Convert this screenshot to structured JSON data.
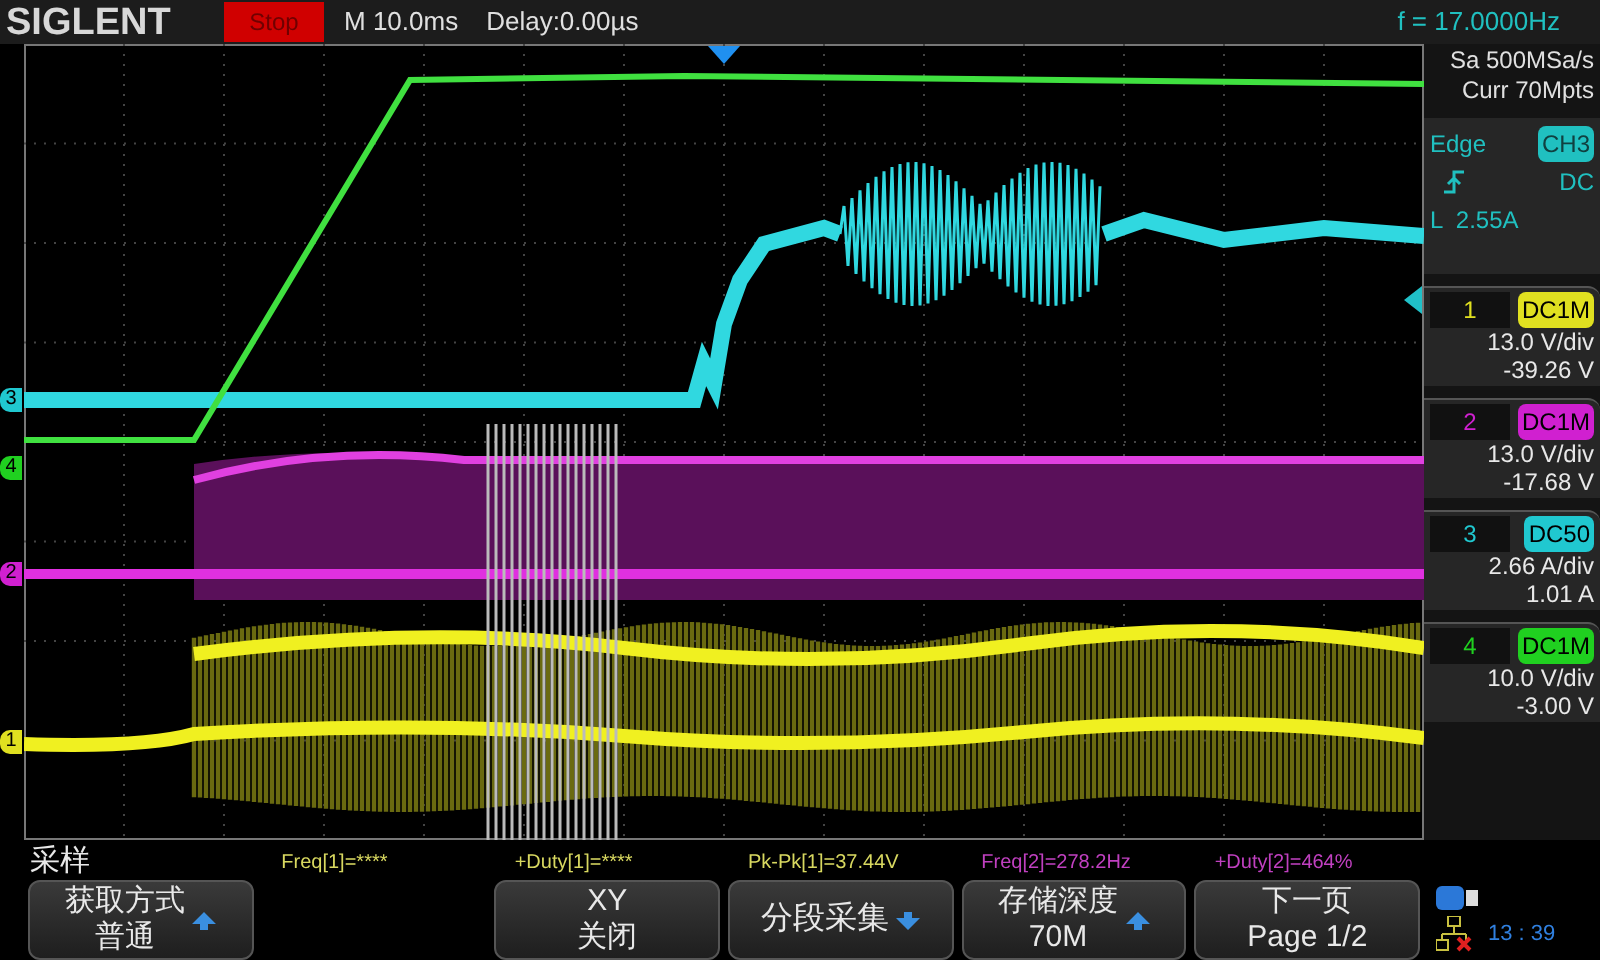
{
  "top_bar": {
    "logo": "SIGLENT",
    "run_state": "Stop",
    "timebase": "M 10.0ms",
    "delay": "Delay:0.00µs",
    "frequency": "f = 17.0000Hz"
  },
  "acquisition": {
    "sample_rate": "Sa 500MSa/s",
    "memory": "Curr 70Mpts"
  },
  "trigger": {
    "type": "Edge",
    "source": "CH3",
    "coupling": "DC",
    "level": "L  2.55A"
  },
  "channels": [
    {
      "number": "1",
      "coupling": "DC1M",
      "scale": "13.0 V/div",
      "offset": "-39.26 V",
      "color": "#e0e020"
    },
    {
      "number": "2",
      "coupling": "DC1M",
      "scale": "13.0 V/div",
      "offset": "-17.68 V",
      "color": "#d020d0"
    },
    {
      "number": "3",
      "coupling": "DC50",
      "scale": "2.66 A/div",
      "offset": "1.01 A",
      "color": "#20c8d0"
    },
    {
      "number": "4",
      "coupling": "DC1M",
      "scale": "10.0 V/div",
      "offset": "-3.00 V",
      "color": "#20d020"
    }
  ],
  "trace_markers": [
    {
      "label": "3",
      "color": "#20c8d0"
    },
    {
      "label": "4",
      "color": "#20d020"
    },
    {
      "label": "2",
      "color": "#d020d0"
    },
    {
      "label": "1",
      "color": "#e0e020"
    }
  ],
  "menu_title": "采样",
  "measurements": [
    {
      "text": "Freq[1]=****",
      "color": "#d8d860"
    },
    {
      "text": "+Duty[1]=****",
      "color": "#d8d860"
    },
    {
      "text": "Pk-Pk[1]=37.44V",
      "color": "#d8d860"
    },
    {
      "text": "Freq[2]=278.2Hz",
      "color": "#c040c0"
    },
    {
      "text": "+Duty[2]=464%",
      "color": "#c040c0"
    }
  ],
  "softkeys": [
    {
      "kind": "two_line",
      "title": "获取方式",
      "value": "普通",
      "arrow": true,
      "arrow_up": true
    },
    {
      "kind": "empty"
    },
    {
      "kind": "two_line",
      "title": "XY",
      "value": "关闭"
    },
    {
      "kind": "single",
      "title": "分段采集",
      "arrow": true,
      "arrow_up": false
    },
    {
      "kind": "two_line",
      "title": "存储深度",
      "value": "70M",
      "arrow": true,
      "arrow_up": true
    },
    {
      "kind": "two_line",
      "title": "下一页",
      "value": "Page 1/2"
    }
  ],
  "status": {
    "time": "13 : 39"
  }
}
